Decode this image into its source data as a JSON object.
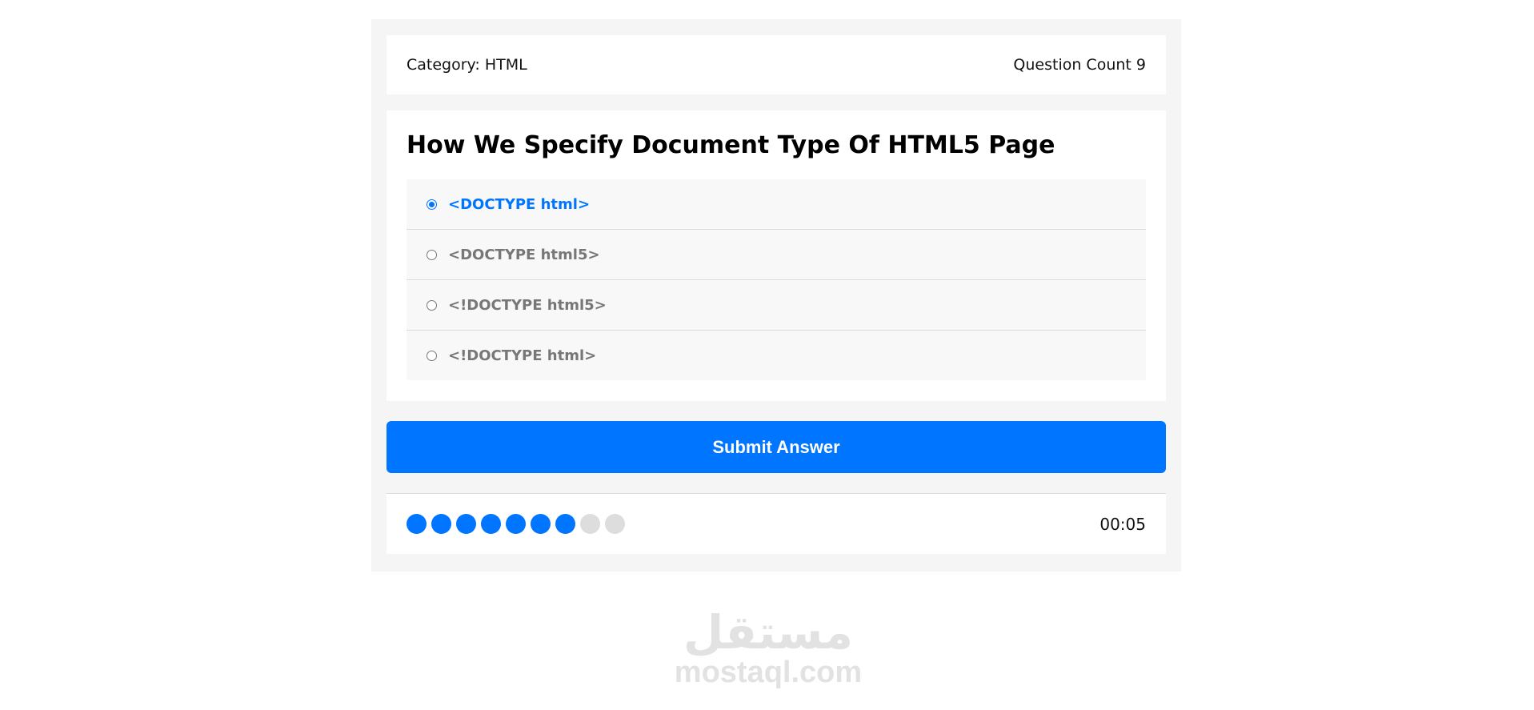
{
  "info": {
    "category_label": "Category:",
    "category_value": "HTML",
    "question_count_label": "Question Count",
    "question_count_value": "9"
  },
  "question": {
    "title": "How We Specify Document Type Of HTML5 Page",
    "answers": [
      {
        "label": "<DOCTYPE html>",
        "selected": true
      },
      {
        "label": "<DOCTYPE html5>",
        "selected": false
      },
      {
        "label": "<!DOCTYPE html5>",
        "selected": false
      },
      {
        "label": "<!DOCTYPE html>",
        "selected": false
      }
    ]
  },
  "submit_label": "Submit Answer",
  "progress": {
    "total": 9,
    "answered": 7
  },
  "countdown": "00:05",
  "watermark": {
    "arabic": "مستقل",
    "latin": "mostaql.com"
  },
  "colors": {
    "accent": "#0075ff",
    "inactive_bullet": "#dddddd",
    "panel_background": "#f5f5f5"
  }
}
